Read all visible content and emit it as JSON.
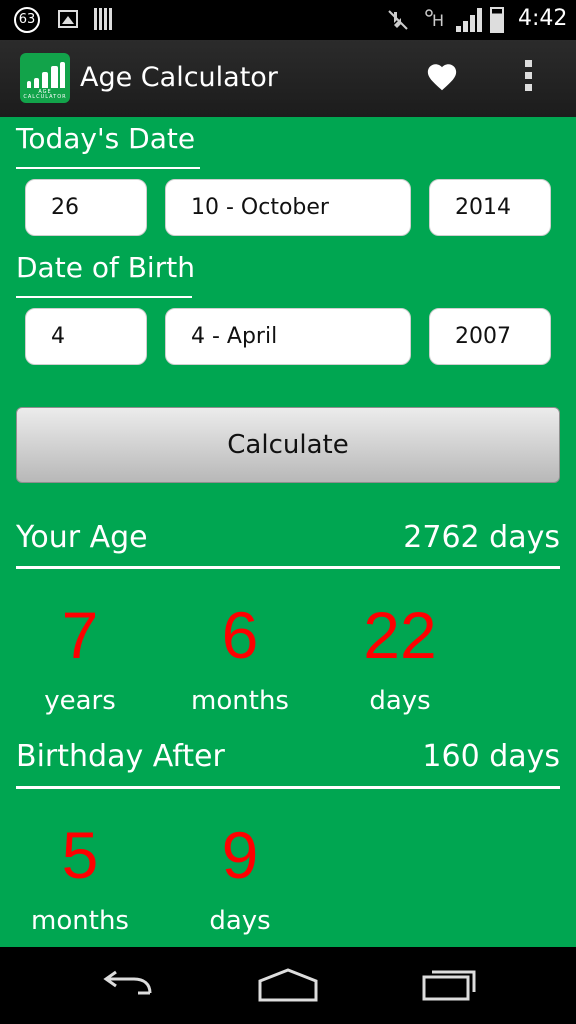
{
  "status_bar": {
    "notification_count": "63",
    "time": "4:42"
  },
  "app_bar": {
    "title": "Age Calculator",
    "logo_text": "AGE CALCULATOR"
  },
  "todays_date": {
    "label": "Today's Date",
    "day": "26",
    "month": "10 - October",
    "year": "2014"
  },
  "date_of_birth": {
    "label": "Date of Birth",
    "day": "4",
    "month": "4 - April",
    "year": "2007"
  },
  "calculate_label": "Calculate",
  "your_age": {
    "label": "Your Age",
    "total": "2762 days",
    "years_value": "7",
    "years_label": "years",
    "months_value": "6",
    "months_label": "months",
    "days_value": "22",
    "days_label": "days"
  },
  "birthday_after": {
    "label": "Birthday After",
    "total": "160 days",
    "months_value": "5",
    "months_label": "months",
    "days_value": "9",
    "days_label": "days"
  },
  "colors": {
    "background": "#00a651",
    "result_number": "#ff0000",
    "action_bar": "#222222"
  },
  "icons": [
    "notification-badge-icon",
    "gallery-icon",
    "barcode-icon",
    "mute-icon",
    "data-h-icon",
    "signal-icon",
    "battery-icon",
    "heart-icon",
    "overflow-menu-icon",
    "back-icon",
    "home-icon",
    "recent-apps-icon"
  ]
}
